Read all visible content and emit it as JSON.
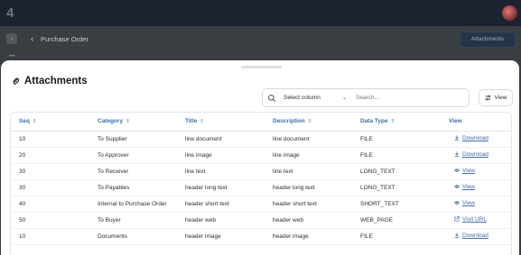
{
  "app": {
    "logo_text": "4"
  },
  "background": {
    "page_title": "Purchase Order",
    "attachments_button": "Attachments"
  },
  "modal": {
    "title": "Attachments",
    "search": {
      "column_select": "Select column",
      "placeholder": "Search..."
    },
    "view_button": "View",
    "table": {
      "columns": [
        "Seq",
        "Category",
        "Title",
        "Description",
        "Data Type",
        "View"
      ],
      "rows": [
        {
          "seq": "10",
          "category": "To Supplier",
          "title": "line document",
          "description": "line document",
          "data_type": "FILE",
          "view": "Download",
          "view_icon": "download-icon"
        },
        {
          "seq": "20",
          "category": "To Approver",
          "title": "line image",
          "description": "line image",
          "data_type": "FILE",
          "view": "Download",
          "view_icon": "download-icon"
        },
        {
          "seq": "30",
          "category": "To Receiver",
          "title": "line text",
          "description": "line text",
          "data_type": "LONG_TEXT",
          "view": "View",
          "view_icon": "eye-icon"
        },
        {
          "seq": "30",
          "category": "To Payables",
          "title": "header long text",
          "description": "header long text",
          "data_type": "LONG_TEXT",
          "view": "View",
          "view_icon": "eye-icon"
        },
        {
          "seq": "40",
          "category": "Internal to Purchase Order",
          "title": "header short text",
          "description": "header short text",
          "data_type": "SHORT_TEXT",
          "view": "View",
          "view_icon": "eye-icon"
        },
        {
          "seq": "50",
          "category": "To Buyer",
          "title": "header web",
          "description": "header web",
          "data_type": "WEB_PAGE",
          "view": "Visit URL",
          "view_icon": "external-link-icon"
        },
        {
          "seq": "10",
          "category": "Documents",
          "title": "header image",
          "description": "header image",
          "data_type": "FILE",
          "view": "Download",
          "view_icon": "download-icon"
        }
      ]
    }
  },
  "colors": {
    "link": "#3d6ea8",
    "header_bar": "#1c2330"
  }
}
